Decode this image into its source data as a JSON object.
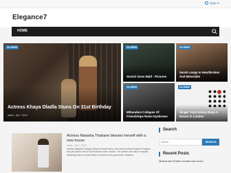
{
  "topbar": {
    "signin_label": "Sign in"
  },
  "header": {
    "logo_text": "Elegance7"
  },
  "nav": {
    "home_label": "HOME"
  },
  "featured": {
    "big": {
      "badge": "ZA NEWS",
      "title": "Actress Khaya Dladla Stuns On 31st Birthday",
      "meta": "admin  -  Apr 7, 2022"
    },
    "small": [
      {
        "badge": "ZA NEWS",
        "title": "Somizi Goes Bald - Pictures"
      },
      {
        "badge": "ZA NEWS",
        "title": "Sarah Langa Is Heartbroken And Miserable"
      },
      {
        "badge": "ZA NEWS",
        "title": "Mthandeni Collapse Of Friendships Raise Eyebrows"
      },
      {
        "badge": "ZA NEWS",
        "title": "Singer Toya Delazy Buys A House In London"
      }
    ]
  },
  "article": {
    "title": "Actress Natasha Thabane blesses herself with a new house",
    "meta": "admin  -  Apr 7, 2022",
    "excerpt": "Actress Natasha Thabane blesses herself with a new house Actress Natasha Thabane has just joined a list of South African home owners. The actress who was in hospital yesterday took to social media to announce the good news. Natasha..."
  },
  "sidebar": {
    "search_title": "Search",
    "search_placeholder": "Search",
    "search_button": "SEARCH",
    "recent_title": "Recent Posts",
    "recent_items": [
      "Mzansi star Emtee reveals how much"
    ]
  },
  "colors": {
    "accent": "#2a7ab8",
    "nav_bg": "#1d1d1d"
  }
}
